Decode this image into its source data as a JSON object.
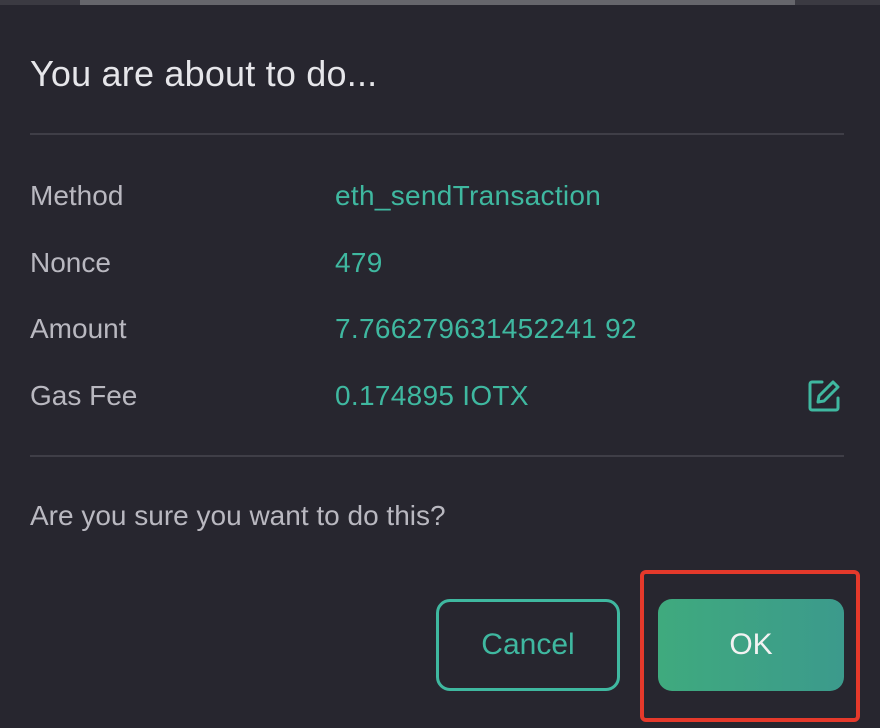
{
  "dialog": {
    "title": "You are about to do...",
    "fields": [
      {
        "label": "Method",
        "value": "eth_sendTransaction"
      },
      {
        "label": "Nonce",
        "value": "479"
      },
      {
        "label": "Amount",
        "value": "7.766279631452241 92"
      },
      {
        "label": "Gas Fee",
        "value": "0.174895 IOTX"
      }
    ],
    "question": "Are you sure you want to do this?",
    "cancel_label": "Cancel",
    "ok_label": "OK",
    "edit_icon": "edit-icon"
  },
  "colors": {
    "background": "#27262f",
    "accent": "#3fb8a0",
    "label": "#b9b8c0",
    "highlight": "#e5392b"
  }
}
